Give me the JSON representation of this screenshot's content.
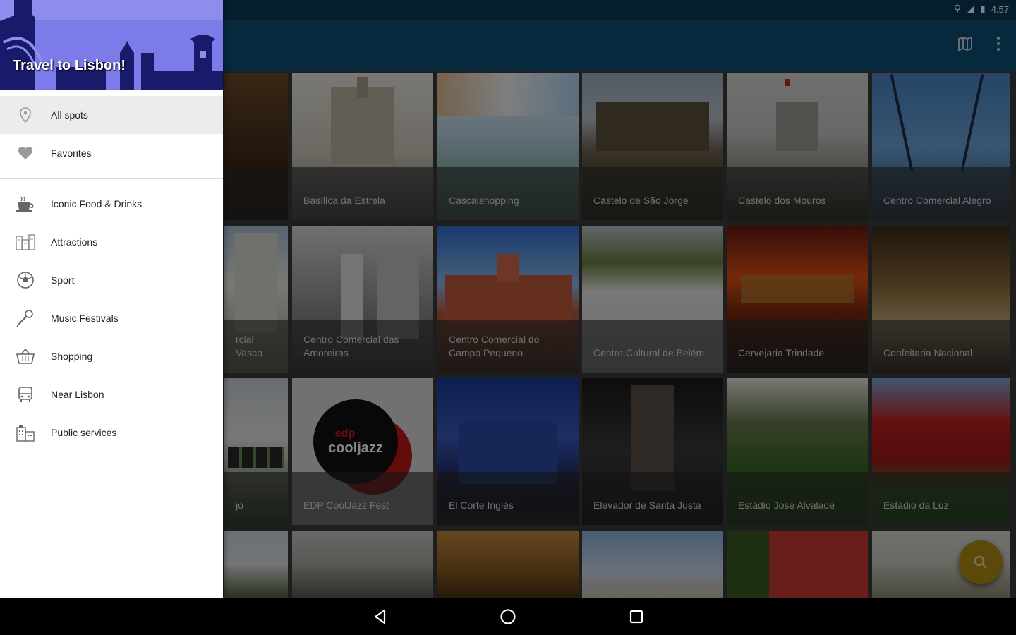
{
  "status_bar": {
    "time": "4:57"
  },
  "drawer": {
    "title": "Travel to Lisbon!",
    "items": [
      {
        "label": "All spots",
        "icon": "location-pin-icon"
      },
      {
        "label": "Favorites",
        "icon": "heart-icon"
      },
      {
        "label": "Iconic Food & Drinks",
        "icon": "coffee-cup-icon"
      },
      {
        "label": "Attractions",
        "icon": "city-icon"
      },
      {
        "label": "Sport",
        "icon": "soccer-ball-icon"
      },
      {
        "label": "Music Festivals",
        "icon": "microphone-icon"
      },
      {
        "label": "Shopping",
        "icon": "shopping-basket-icon"
      },
      {
        "label": "Near Lisbon",
        "icon": "bus-icon"
      },
      {
        "label": "Public services",
        "icon": "building-icon"
      }
    ]
  },
  "grid": {
    "tiles": [
      {
        "caption": ""
      },
      {
        "caption": "Basílica da Estrela"
      },
      {
        "caption": "Cascaishopping"
      },
      {
        "caption": "Castelo de São Jorge"
      },
      {
        "caption": "Castelo dos Mouros"
      },
      {
        "caption": "Centro Comercial Alegro"
      },
      {
        "caption": "rcial Vasco"
      },
      {
        "caption": "Centro Comercial das Amoreiras"
      },
      {
        "caption": "Centro Comercial do Campo Pequeno"
      },
      {
        "caption": "Centro Cultural de Belém"
      },
      {
        "caption": "Cervejaria Trindade"
      },
      {
        "caption": "Confeitaria Nacional"
      },
      {
        "caption": "jo"
      },
      {
        "caption": "EDP CoolJazz Fest"
      },
      {
        "caption": "El Corte Inglés"
      },
      {
        "caption": "Elevador de Santa Justa"
      },
      {
        "caption": "Estádio José Alvalade"
      },
      {
        "caption": "Estádio da Luz"
      }
    ],
    "logo_text": "cooljazz",
    "logo_brand": "edp"
  },
  "colors": {
    "app_bar": "#0e4f78",
    "status_bar": "#0b3a59",
    "drawer_header": "#7b7bea",
    "fab": "#b08a12"
  }
}
